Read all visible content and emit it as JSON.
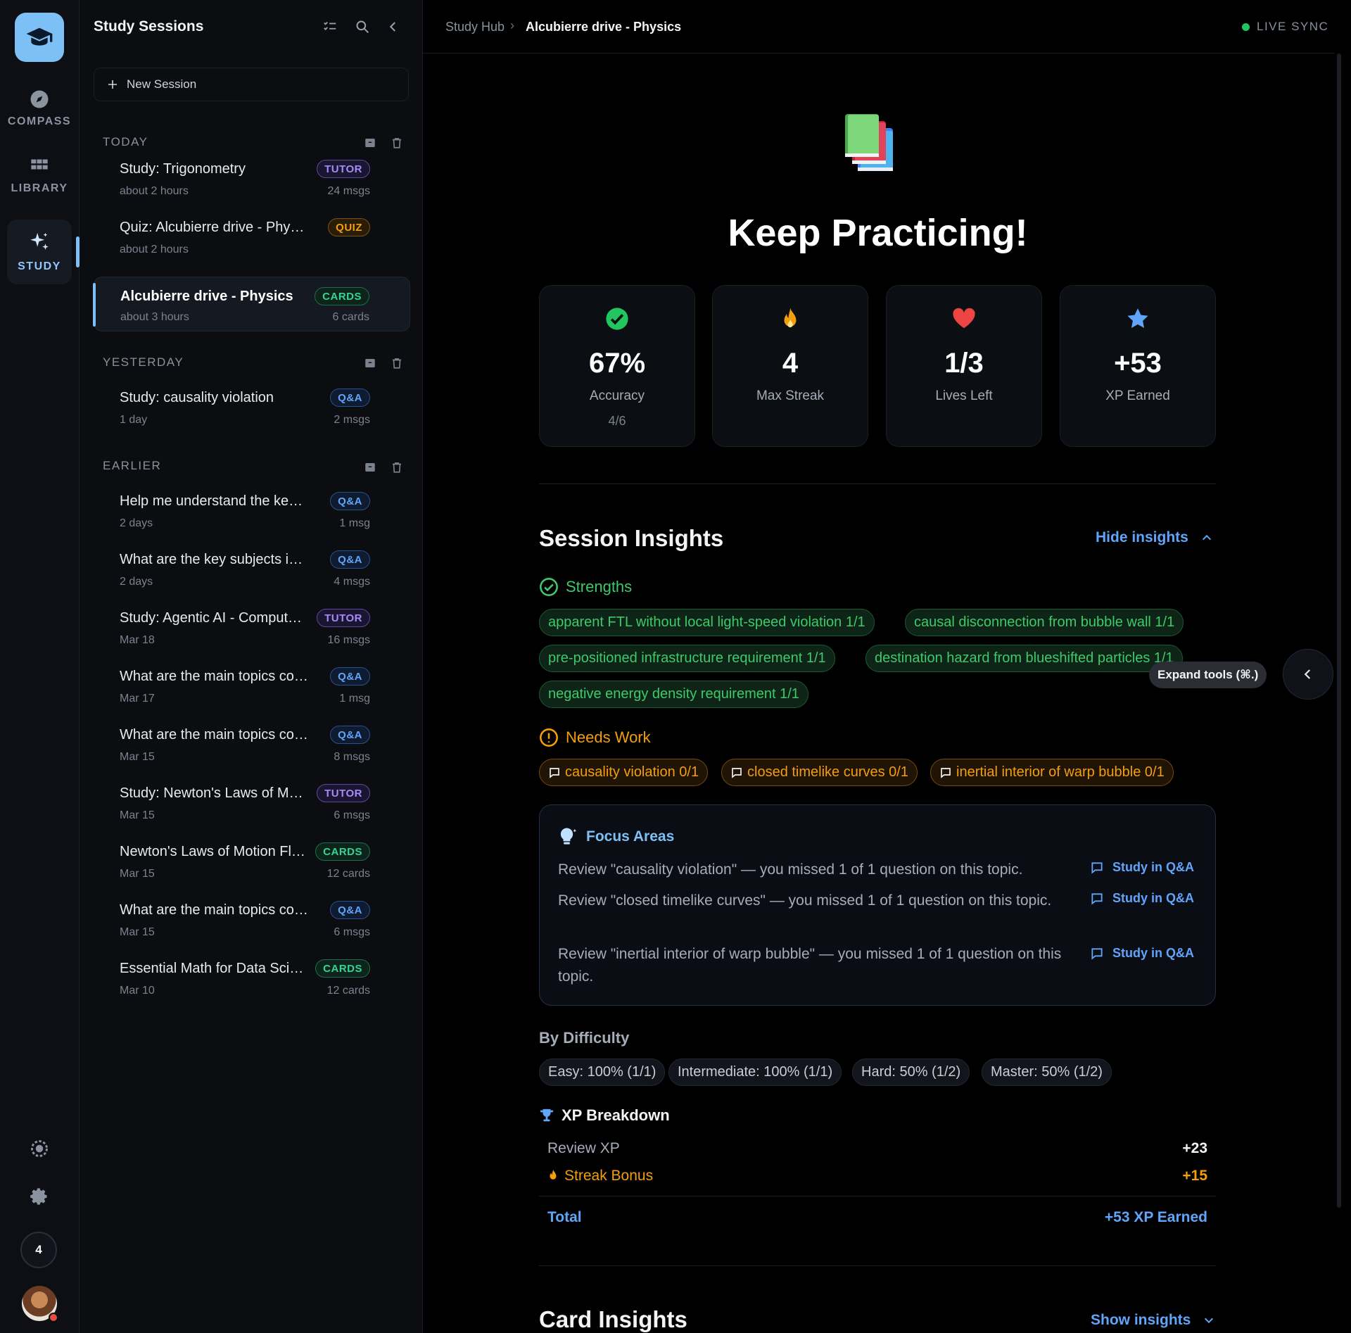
{
  "rail": {
    "items": [
      {
        "label": "COMPASS"
      },
      {
        "label": "LIBRARY"
      },
      {
        "label": "STUDY"
      }
    ],
    "streak_count": "4"
  },
  "sidebar": {
    "title": "Study Sessions",
    "new_session": "New Session",
    "groups": {
      "today": "TODAY",
      "yesterday": "YESTERDAY",
      "earlier": "EARLIER"
    },
    "sessions": [
      {
        "title": "Study: Trigonometry",
        "badge": "TUTOR",
        "time": "about 2 hours",
        "count": "24 msgs"
      },
      {
        "title": "Quiz: Alcubierre drive - Physics",
        "badge": "QUIZ",
        "time": "about 2 hours",
        "count": ""
      },
      {
        "title": "Alcubierre drive - Physics",
        "badge": "CARDS",
        "time": "about 3 hours",
        "count": "6 cards"
      },
      {
        "title": "Study: causality violation",
        "badge": "Q&A",
        "time": "1 day",
        "count": "2 msgs"
      },
      {
        "title": "Help me understand the key concepts",
        "badge": "Q&A",
        "time": "2 days",
        "count": "1 msg"
      },
      {
        "title": "What are the key subjects in this",
        "badge": "Q&A",
        "time": "2 days",
        "count": "4 msgs"
      },
      {
        "title": "Study: Agentic AI - Computer Use",
        "badge": "TUTOR",
        "time": "Mar 18",
        "count": "16 msgs"
      },
      {
        "title": "What are the main topics covered",
        "badge": "Q&A",
        "time": "Mar 17",
        "count": "1 msg"
      },
      {
        "title": "What are the main topics covered",
        "badge": "Q&A",
        "time": "Mar 15",
        "count": "8 msgs"
      },
      {
        "title": "Study: Newton's Laws of Motion",
        "badge": "TUTOR",
        "time": "Mar 15",
        "count": "6 msgs"
      },
      {
        "title": "Newton's Laws of Motion Flashcards",
        "badge": "CARDS",
        "time": "Mar 15",
        "count": "12 cards"
      },
      {
        "title": "What are the main topics covered",
        "badge": "Q&A",
        "time": "Mar 15",
        "count": "6 msgs"
      },
      {
        "title": "Essential Math for Data Science",
        "badge": "CARDS",
        "time": "Mar 10",
        "count": "12 cards"
      }
    ]
  },
  "header": {
    "breadcrumb_root": "Study Hub",
    "breadcrumb_current": "Alcubierre drive - Physics",
    "live_sync": "LIVE SYNC"
  },
  "results": {
    "title": "Keep Practicing!",
    "stats": [
      {
        "value": "67%",
        "label": "Accuracy",
        "sub": "4/6",
        "icon": "check-circle-icon",
        "color": "#22c55e"
      },
      {
        "value": "4",
        "label": "Max Streak",
        "sub": "",
        "icon": "flame-icon",
        "color": "#f59e0b"
      },
      {
        "value": "1/3",
        "label": "Lives Left",
        "sub": "",
        "icon": "heart-icon",
        "color": "#ef4444"
      },
      {
        "value": "+53",
        "label": "XP Earned",
        "sub": "",
        "icon": "star-icon",
        "color": "#60a5fa"
      }
    ]
  },
  "session_insights": {
    "title": "Session Insights",
    "toggle": "Hide insights",
    "strengths_label": "Strengths",
    "strengths": [
      "apparent FTL without local light-speed violation 1/1",
      "causal disconnection from bubble wall 1/1",
      "pre-positioned infrastructure requirement 1/1",
      "destination hazard from blueshifted particles 1/1",
      "negative energy density requirement 1/1"
    ],
    "needs_work_label": "Needs Work",
    "needs_work": [
      "causality violation 0/1",
      "closed timelike curves 0/1",
      "inertial interior of warp bubble 0/1"
    ],
    "focus": {
      "title": "Focus Areas",
      "items": [
        {
          "text": "Review \"causality violation\" — you missed 1 of 1 question on this topic.",
          "link": "Study in Q&A"
        },
        {
          "text": "Review \"closed timelike curves\" — you missed 1 of 1 question on this topic.",
          "link": "Study in Q&A"
        },
        {
          "text": "Review \"inertial interior of warp bubble\" — you missed 1 of 1 question on this topic.",
          "link": "Study in Q&A"
        }
      ]
    },
    "difficulty_label": "By Difficulty",
    "difficulty": [
      "Easy: 100% (1/1)",
      "Intermediate: 100% (1/1)",
      "Hard: 50% (1/2)",
      "Master: 50% (1/2)"
    ],
    "xp": {
      "title": "XP Breakdown",
      "review_label": "Review XP",
      "review_value": "+23",
      "streak_label": "Streak Bonus",
      "streak_value": "+15",
      "total_label": "Total",
      "total_value": "+53 XP Earned"
    }
  },
  "card_insights": {
    "title": "Card Insights",
    "toggle": "Show insights"
  },
  "tools": {
    "tooltip": "Expand tools (⌘.)"
  }
}
